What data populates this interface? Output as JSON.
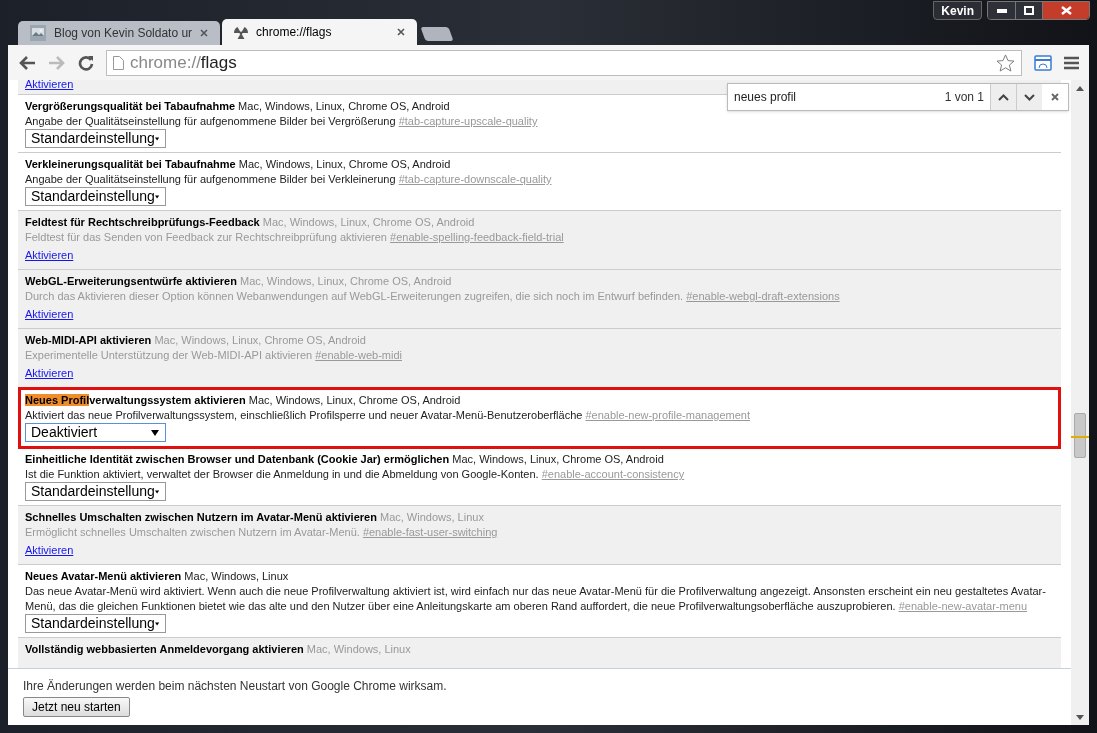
{
  "window": {
    "profile_button": "Kevin"
  },
  "tabs": [
    {
      "title": "Blog von Kevin Soldato ur",
      "selected": false
    },
    {
      "title": "chrome://flags",
      "selected": true
    }
  ],
  "address_bar": {
    "scheme": "chrome://",
    "path": "flags"
  },
  "find_bar": {
    "value": "neues profil",
    "count": "1 von 1"
  },
  "top_partial_link": "Aktivieren",
  "experiments": [
    {
      "title": "Vergrößerungsqualität bei Tabaufnahme",
      "platforms": "Mac, Windows, Linux, Chrome OS, Android",
      "description": "Angabe der Qualitätseinstellung für aufgenommene Bilder bei Vergrößerung",
      "anchor": "#tab-capture-upscale-quality",
      "enabled": true,
      "kind": "select",
      "control": "Standardeinstellung",
      "focused": false
    },
    {
      "title": "Verkleinerungsqualität bei Tabaufnahme",
      "platforms": "Mac, Windows, Linux, Chrome OS, Android",
      "description": "Angabe der Qualitätseinstellung für aufgenommene Bilder bei Verkleinerung",
      "anchor": "#tab-capture-downscale-quality",
      "enabled": true,
      "kind": "select",
      "control": "Standardeinstellung",
      "focused": false
    },
    {
      "title": "Feldtest für Rechtschreibprüfungs-Feedback",
      "platforms": "Mac, Windows, Linux, Chrome OS, Android",
      "description": "Feldtest für das Senden von Feedback zur Rechtschreibprüfung aktivieren",
      "anchor": "#enable-spelling-feedback-field-trial",
      "enabled": false,
      "kind": "link",
      "control": "Aktivieren",
      "focused": false
    },
    {
      "title": "WebGL-Erweiterungsentwürfe aktivieren",
      "platforms": "Mac, Windows, Linux, Chrome OS, Android",
      "description": "Durch das Aktivieren dieser Option können Webanwendungen auf WebGL-Erweiterungen zugreifen, die sich noch im Entwurf befinden.",
      "anchor": "#enable-webgl-draft-extensions",
      "enabled": false,
      "kind": "link",
      "control": "Aktivieren",
      "focused": false
    },
    {
      "title": "Web-MIDI-API aktivieren",
      "platforms": "Mac, Windows, Linux, Chrome OS, Android",
      "description": "Experimentelle Unterstützung der Web-MIDI-API aktivieren",
      "anchor": "#enable-web-midi",
      "enabled": false,
      "kind": "link",
      "control": "Aktivieren",
      "focused": false
    },
    {
      "title_match": "Neues Profil",
      "title": "verwaltungssystem aktivieren",
      "platforms": "Mac, Windows, Linux, Chrome OS, Android",
      "description": "Aktiviert das neue Profilverwaltungssystem, einschließlich Profilsperre und neuer Avatar-Menü-Benutzeroberfläche",
      "anchor": "#enable-new-profile-management",
      "enabled": true,
      "kind": "select",
      "control": "Deaktiviert",
      "focused": true
    },
    {
      "title": "Einheitliche Identität zwischen Browser und Datenbank (Cookie Jar) ermöglichen",
      "platforms": "Mac, Windows, Linux, Chrome OS, Android",
      "description": "Ist die Funktion aktiviert, verwaltet der Browser die Anmeldung in und die Abmeldung von Google-Konten.",
      "anchor": "#enable-account-consistency",
      "enabled": true,
      "kind": "select",
      "control": "Standardeinstellung",
      "focused": false
    },
    {
      "title": "Schnelles Umschalten zwischen Nutzern im Avatar-Menü aktivieren",
      "platforms": "Mac, Windows, Linux",
      "description": "Ermöglicht schnelles Umschalten zwischen Nutzern im Avatar-Menü.",
      "anchor": "#enable-fast-user-switching",
      "enabled": false,
      "kind": "link",
      "control": "Aktivieren",
      "focused": false
    },
    {
      "title": "Neues Avatar-Menü aktivieren",
      "platforms": "Mac, Windows, Linux",
      "description": "Das neue Avatar-Menü wird aktiviert. Wenn auch die neue Profilverwaltung aktiviert ist, wird einfach nur das neue Avatar-Menü für die Profilverwaltung angezeigt. Ansonsten erscheint ein neu gestaltetes Avatar-Menü, das die gleichen Funktionen bietet wie das alte und den Nutzer über eine Anleitungskarte am oberen Rand auffordert, die neue Profilverwaltungsoberfläche auszuprobieren.",
      "anchor": "#enable-new-avatar-menu",
      "enabled": true,
      "kind": "select",
      "control": "Standardeinstellung",
      "focused": false
    },
    {
      "title": "Vollständig webbasierten Anmeldevorgang aktivieren",
      "platforms": "Mac, Windows, Linux",
      "enabled": false,
      "kind": "partial",
      "focused": false
    }
  ],
  "footer": {
    "message": "Ihre Änderungen werden beim nächsten Neustart von Google Chrome wirksam.",
    "button": "Jetzt neu starten"
  }
}
